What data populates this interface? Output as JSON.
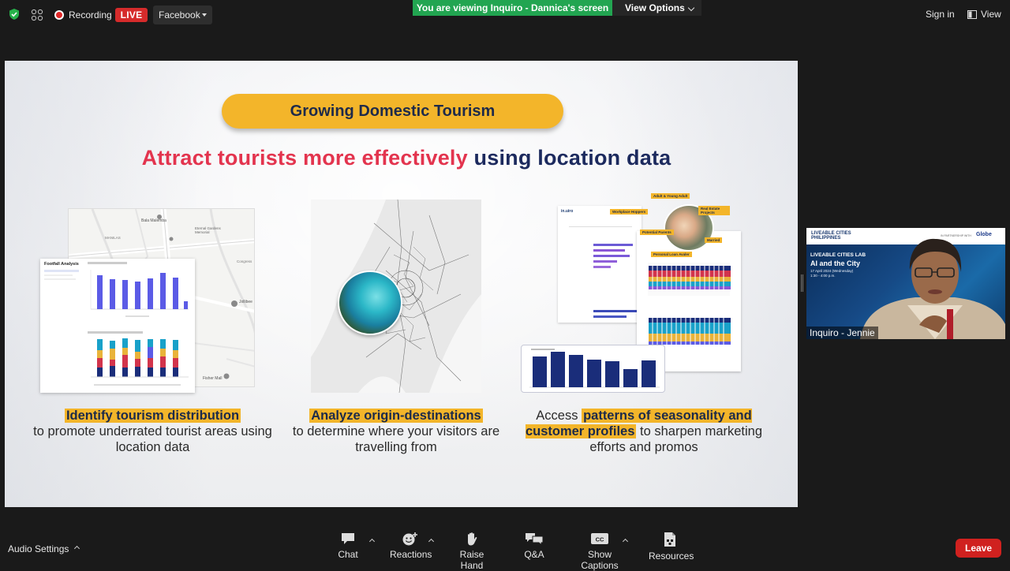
{
  "topbar": {
    "recording_label": "Recording",
    "live_label": "LIVE",
    "stream_target": "Facebook",
    "viewing_banner": "You are viewing Inquiro - Dannica's screen",
    "view_options_label": "View Options",
    "sign_in_label": "Sign in",
    "view_label": "View"
  },
  "slide": {
    "pill_title": "Growing Domestic Tourism",
    "headline_red": "Attract tourists more effectively",
    "headline_navy": "using location data",
    "card1": {
      "panel_title": "Footfall Analysis",
      "caption_hl": "Identify tourism distribution",
      "caption_rest": "to promote underrated tourist areas using location data"
    },
    "card2": {
      "caption_hl": "Analyze origin-destinations",
      "caption_rest": "to determine where your visitors are travelling from"
    },
    "card3": {
      "caption_pre": "Access",
      "caption_hl": "patterns of seasonality and customer profiles",
      "caption_rest": "to sharpen marketing efforts and promos"
    },
    "map1_labels": [
      "Bala Malemba",
      "Eternal Gardens Memorial",
      "Jollibee",
      "Fisher Mall",
      "MANILAS",
      "Congress"
    ],
    "report_tags": [
      "Adult & Young Adult",
      "Real Estate Projects",
      "Workplace Hoppers",
      "Potential Parents",
      "Married",
      "Personal Loan Avaler"
    ]
  },
  "video": {
    "org_logo": "LIVEABLE CITIES PHILIPPINES",
    "partner_text": "IN PARTNERSHIP WITH",
    "partner_brand": "Globe",
    "event_series": "LIVEABLE CITIES LAB",
    "event_title": "AI and the City",
    "event_date": "17 April 2024 (Wednesday)",
    "event_time": "1:30 - 4:00 p.m.",
    "participant_name": "Inquiro - Jennie"
  },
  "toolbar": {
    "audio_settings": "Audio Settings",
    "chat": "Chat",
    "reactions": "Reactions",
    "raise_hand": "Raise Hand",
    "qa": "Q&A",
    "show_captions": "Show Captions",
    "resources": "Resources",
    "leave": "Leave"
  },
  "colors": {
    "live_red": "#d62b2b",
    "banner_green": "#22a551",
    "pill_yellow": "#f3b52a",
    "headline_red": "#e3344e",
    "headline_navy": "#1c2a5e",
    "leave_red": "#d0211f",
    "bar_blue": "#5b5be6",
    "bar_navy": "#1a2d7a"
  },
  "icons": [
    "shield-icon",
    "grid-icon",
    "record-icon",
    "view-icon",
    "chat-icon",
    "reactions-icon",
    "raise-hand-icon",
    "qa-icon",
    "captions-icon",
    "resources-icon"
  ]
}
